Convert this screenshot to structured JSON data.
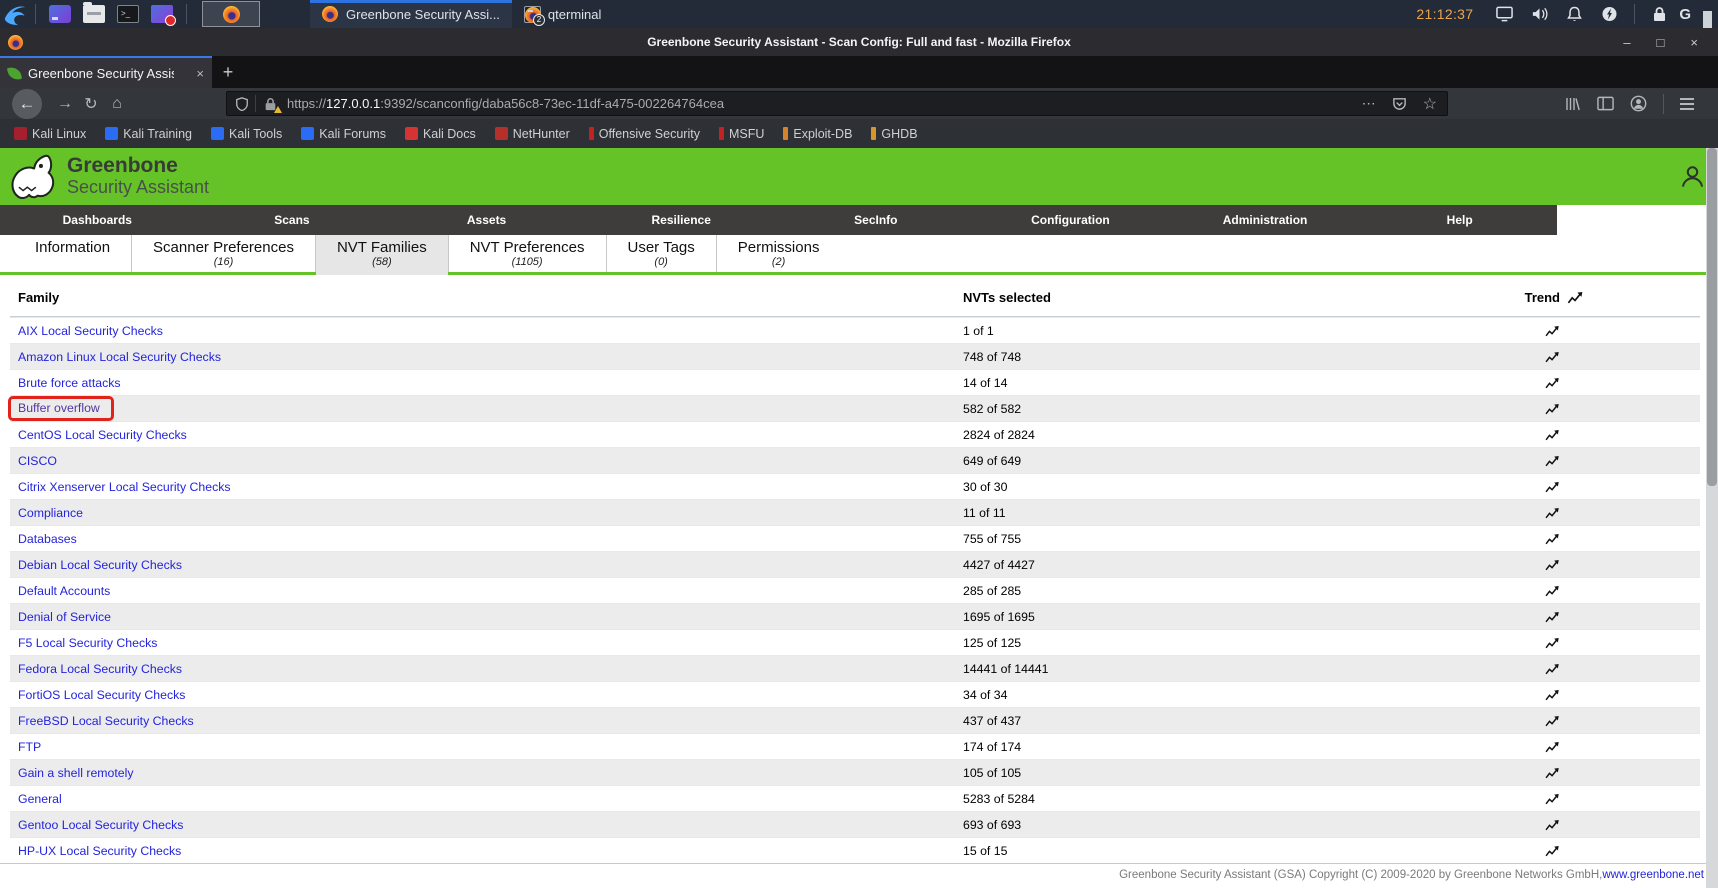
{
  "colors": {
    "accent_green": "#66c327",
    "link_blue": "#2323dd",
    "visited_purple": "#5436a0",
    "highlight_red": "#e0241b",
    "active_tab_blue": "#3b78e7"
  },
  "icons": {
    "minimize": "–",
    "maximize": "□",
    "close": "×",
    "tab_close": "×",
    "new_tab": "+",
    "back": "←",
    "forward": "→",
    "reload": "↻",
    "home": "⌂",
    "more": "⋯",
    "star": "☆",
    "g_indicator": "G"
  },
  "desktop": {
    "clock": "21:12:37",
    "windows": [
      {
        "label": "Greenbone Security Assi...",
        "active": true
      },
      {
        "label": "qterminal",
        "badge": "2",
        "terminal": true
      }
    ]
  },
  "browser": {
    "window_title": "Greenbone Security Assistant - Scan Config: Full and fast - Mozilla Firefox",
    "tab_title": "Greenbone Security Assis",
    "url": {
      "scheme": "https://",
      "host": "127.0.0.1",
      "rest": ":9392/scanconfig/daba56c8-73ec-11df-a475-002264764cea"
    },
    "bookmarks": [
      {
        "label": "Kali Linux",
        "color": "#a51f2d"
      },
      {
        "label": "Kali Training",
        "color": "#2a6df4"
      },
      {
        "label": "Kali Tools",
        "color": "#2a6df4"
      },
      {
        "label": "Kali Forums",
        "color": "#2a6df4"
      },
      {
        "label": "Kali Docs",
        "color": "#d63333"
      },
      {
        "label": "NetHunter",
        "color": "#b5302a"
      },
      {
        "label": "Offensive Security",
        "color": "#c22222",
        "thin": true
      },
      {
        "label": "MSFU",
        "color": "#c22222",
        "thin": true
      },
      {
        "label": "Exploit-DB",
        "color": "#d7832c",
        "thin": true
      },
      {
        "label": "GHDB",
        "color": "#d7952c",
        "thin": true
      }
    ]
  },
  "gsa": {
    "brand": {
      "title": "Greenbone",
      "subtitle": "Security Assistant"
    },
    "menu": [
      {
        "label": "Dashboards"
      },
      {
        "label": "Scans"
      },
      {
        "label": "Assets"
      },
      {
        "label": "Resilience"
      },
      {
        "label": "SecInfo"
      },
      {
        "label": "Configuration"
      },
      {
        "label": "Administration"
      },
      {
        "label": "Help"
      }
    ],
    "tabs": [
      {
        "label": "Information",
        "count": ""
      },
      {
        "label": "Scanner Preferences",
        "count": "(16)"
      },
      {
        "label": "NVT Families",
        "count": "(58)",
        "active": true
      },
      {
        "label": "NVT Preferences",
        "count": "(1105)"
      },
      {
        "label": "User Tags",
        "count": "(0)"
      },
      {
        "label": "Permissions",
        "count": "(2)"
      }
    ],
    "table": {
      "col_family": "Family",
      "col_selected": "NVTs selected",
      "col_trend": "Trend",
      "rows": [
        {
          "family": "AIX Local Security Checks",
          "selected": "1 of 1"
        },
        {
          "family": "Amazon Linux Local Security Checks",
          "selected": "748 of 748"
        },
        {
          "family": "Brute force attacks",
          "selected": "14 of 14"
        },
        {
          "family": "Buffer overflow",
          "selected": "582 of 582",
          "highlight": true,
          "visited": true
        },
        {
          "family": "CentOS Local Security Checks",
          "selected": "2824 of 2824"
        },
        {
          "family": "CISCO",
          "selected": "649 of 649"
        },
        {
          "family": "Citrix Xenserver Local Security Checks",
          "selected": "30 of 30"
        },
        {
          "family": "Compliance",
          "selected": "11 of 11"
        },
        {
          "family": "Databases",
          "selected": "755 of 755"
        },
        {
          "family": "Debian Local Security Checks",
          "selected": "4427 of 4427"
        },
        {
          "family": "Default Accounts",
          "selected": "285 of 285"
        },
        {
          "family": "Denial of Service",
          "selected": "1695 of 1695"
        },
        {
          "family": "F5 Local Security Checks",
          "selected": "125 of 125"
        },
        {
          "family": "Fedora Local Security Checks",
          "selected": "14441 of 14441"
        },
        {
          "family": "FortiOS Local Security Checks",
          "selected": "34 of 34"
        },
        {
          "family": "FreeBSD Local Security Checks",
          "selected": "437 of 437"
        },
        {
          "family": "FTP",
          "selected": "174 of 174"
        },
        {
          "family": "Gain a shell remotely",
          "selected": "105 of 105"
        },
        {
          "family": "General",
          "selected": "5283 of 5284"
        },
        {
          "family": "Gentoo Local Security Checks",
          "selected": "693 of 693"
        },
        {
          "family": "HP-UX Local Security Checks",
          "selected": "15 of 15"
        }
      ]
    },
    "footer": {
      "text": "Greenbone Security Assistant (GSA) Copyright (C) 2009-2020 by Greenbone Networks GmbH, ",
      "link": "www.greenbone.net"
    }
  }
}
